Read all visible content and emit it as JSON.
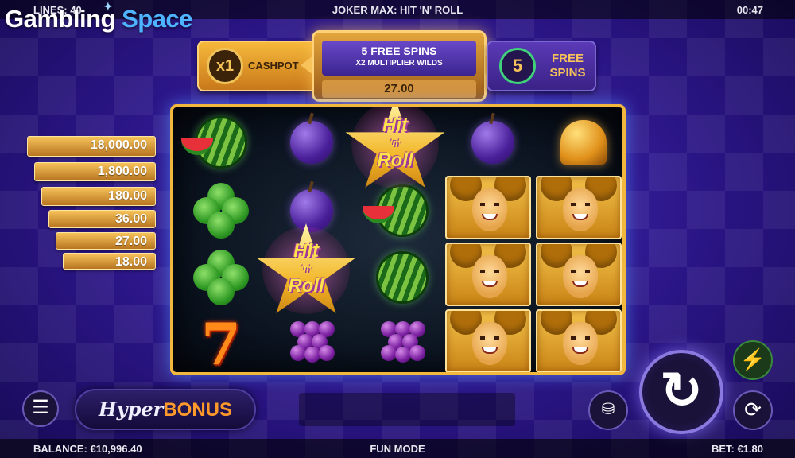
{
  "top_bar": {
    "lines": "LINES: 40",
    "game_title": "JOKER MAX: HIT 'N' ROLL",
    "clock": "00:47"
  },
  "logo": {
    "word1": "Gambling",
    "word2": "Space"
  },
  "bonus_header": {
    "cashpot_multiplier": "x1",
    "cashpot_label": "CASHPOT",
    "free_spins_title": "5 FREE SPINS",
    "multiplier_wilds": "X2 MULTIPLIER WILDS",
    "amount": "27.00",
    "free_spins_count": "5",
    "free_spins_label": "FREE SPINS"
  },
  "paytable": [
    "18,000.00",
    "1,800.00",
    "180.00",
    "36.00",
    "27.00",
    "18.00"
  ],
  "reels": {
    "star_text_big": "Hit",
    "star_text_small": "'n'",
    "star_text_big2": "Roll"
  },
  "controls": {
    "hyper_word": "Hyper",
    "bonus_word": "BONUS",
    "menu_icon": "menu-icon",
    "spin_icon": "spin-arrow-icon",
    "turbo_icon": "lightning-icon",
    "auto_icon": "autoplay-icon",
    "stack_icon": "coin-stack-icon"
  },
  "bottom_bar": {
    "balance": "BALANCE: €10,996.40",
    "mode": "FUN MODE",
    "bet": "BET: €1.80"
  },
  "colors": {
    "frame_gold": "#f2b73d",
    "accent_orange": "#ff9a2a",
    "background_purple": "#2a1585",
    "logo_blue": "#4fb4ff"
  }
}
